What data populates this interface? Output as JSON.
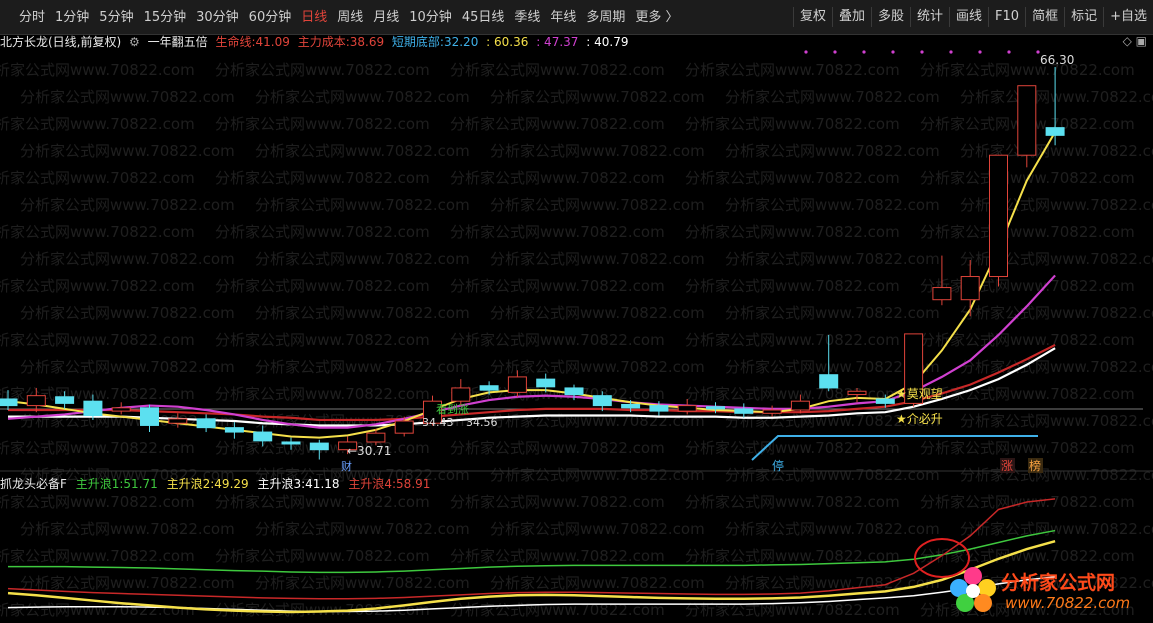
{
  "toolbar": {
    "periods": [
      "分时",
      "1分钟",
      "5分钟",
      "15分钟",
      "30分钟",
      "60分钟",
      "日线",
      "周线",
      "月线",
      "10分钟",
      "45日线",
      "季线",
      "年线",
      "多周期",
      "更多 〉"
    ],
    "active_period": "日线",
    "tools": [
      "复权",
      "叠加",
      "多股",
      "统计",
      "画线",
      "F10",
      "简框",
      "标记",
      "+自选"
    ]
  },
  "upper_info": {
    "stock": "北方长龙(日线,前复权)",
    "indicator_name": "一年翻五倍",
    "life_label": "生命线:",
    "life_value": "41.09",
    "cost_label": "主力成本:",
    "cost_value": "38.69",
    "bottom_label": "短期底部:",
    "bottom_value": "32.20",
    "v1": ": 60.36",
    "v2": ": 47.37",
    "v3": ": 40.79",
    "colors": {
      "life": "#e0443a",
      "cost": "#e0443a",
      "bottom": "#3fb0e8",
      "v1": "#f5e04a",
      "v2": "#d040d0",
      "v3": "#ffffff"
    }
  },
  "lower_info": {
    "indicator_name": "抓龙头必备F",
    "w1_label": "主升浪1:",
    "w1_value": "51.71",
    "w2_label": "主升浪2:",
    "w2_value": "49.29",
    "w3_label": "主升浪3:",
    "w3_value": "41.18",
    "w4_label": "主升浪4:",
    "w4_value": "58.91",
    "colors": {
      "w1": "#3ec83e",
      "w2": "#f5e04a",
      "w3": "#ffffff",
      "w4": "#e0443a"
    }
  },
  "annotations": {
    "high_price": "66.30",
    "low_price": "←30.71",
    "low_label": "财",
    "p1": "34.43",
    "p2": "34.56",
    "see_up": "看到涨",
    "watch": "★莫观望",
    "must_rise": "★介必升",
    "stop": "停",
    "rise": "涨",
    "rank": "榜"
  },
  "watermark": "分析家公式网www.70822.com",
  "logo": {
    "text": "分析家公式网",
    "url": "www.70822.com"
  },
  "chart_data": {
    "type": "candlestick",
    "candles": [
      [
        36.2,
        35.6,
        37.0,
        35.2
      ],
      [
        35.6,
        36.5,
        37.2,
        35.0
      ],
      [
        36.4,
        35.8,
        36.9,
        35.3
      ],
      [
        36.0,
        34.7,
        36.6,
        34.3
      ],
      [
        35.1,
        35.4,
        35.9,
        34.8
      ],
      [
        35.4,
        33.8,
        35.7,
        33.2
      ],
      [
        34.0,
        34.4,
        34.9,
        33.6
      ],
      [
        34.4,
        33.6,
        34.8,
        33.2
      ],
      [
        33.6,
        33.2,
        34.1,
        32.6
      ],
      [
        33.2,
        32.4,
        33.8,
        31.9
      ],
      [
        32.3,
        32.2,
        32.7,
        31.6
      ],
      [
        32.2,
        31.6,
        32.5,
        30.71
      ],
      [
        31.6,
        32.3,
        32.8,
        31.2
      ],
      [
        32.3,
        33.1,
        33.5,
        32.0
      ],
      [
        33.1,
        34.2,
        34.6,
        32.8
      ],
      [
        34.0,
        36.0,
        36.5,
        33.8
      ],
      [
        36.0,
        37.2,
        38.0,
        35.6
      ],
      [
        37.4,
        37.0,
        37.8,
        36.6
      ],
      [
        36.8,
        38.2,
        38.8,
        36.4
      ],
      [
        38.0,
        37.3,
        38.5,
        36.8
      ],
      [
        37.2,
        36.6,
        37.5,
        36.1
      ],
      [
        36.5,
        35.6,
        36.9,
        35.1
      ],
      [
        35.7,
        35.4,
        36.1,
        35.0
      ],
      [
        35.6,
        35.1,
        36.0,
        34.7
      ],
      [
        35.1,
        35.6,
        36.2,
        34.8
      ],
      [
        35.5,
        35.3,
        35.9,
        34.9
      ],
      [
        35.3,
        34.9,
        35.8,
        34.5
      ],
      [
        34.9,
        35.2,
        35.6,
        34.6
      ],
      [
        35.2,
        36.0,
        36.6,
        34.9
      ],
      [
        38.4,
        37.2,
        42.0,
        36.9
      ],
      [
        36.6,
        36.9,
        37.2,
        35.9
      ],
      [
        36.2,
        35.8,
        36.6,
        35.4
      ],
      [
        35.8,
        42.1,
        42.1,
        35.5
      ],
      [
        45.2,
        46.3,
        49.2,
        44.7
      ],
      [
        45.2,
        47.3,
        48.8,
        43.7
      ],
      [
        47.3,
        58.3,
        58.3,
        46.4
      ],
      [
        58.3,
        64.6,
        64.6,
        57.2
      ],
      [
        60.8,
        60.1,
        66.3,
        59.2
      ]
    ],
    "lines": {
      "yellow": [
        36.0,
        35.7,
        35.3,
        34.9,
        34.6,
        34.3,
        34.0,
        33.7,
        33.4,
        33.1,
        32.8,
        32.7,
        32.9,
        33.4,
        34.2,
        35.2,
        36.2,
        36.8,
        37.0,
        37.0,
        36.7,
        36.3,
        35.9,
        35.6,
        35.4,
        35.2,
        35.1,
        35.0,
        35.3,
        36.0,
        36.3,
        36.2,
        37.6,
        40.6,
        44.3,
        49.8,
        56.0,
        60.4
      ],
      "magenta": [
        34.4,
        34.6,
        34.8,
        35.1,
        35.4,
        35.6,
        35.5,
        35.2,
        34.8,
        34.3,
        33.9,
        33.6,
        33.6,
        33.9,
        34.4,
        35.0,
        35.6,
        36.1,
        36.4,
        36.5,
        36.4,
        36.2,
        35.9,
        35.7,
        35.6,
        35.5,
        35.4,
        35.3,
        35.3,
        35.5,
        35.8,
        36.0,
        36.9,
        38.2,
        39.7,
        42.0,
        44.6,
        47.4
      ],
      "red": [
        35.2,
        35.2,
        35.2,
        35.2,
        35.2,
        35.1,
        35.0,
        34.9,
        34.8,
        34.6,
        34.5,
        34.3,
        34.3,
        34.3,
        34.4,
        34.6,
        34.8,
        35.0,
        35.2,
        35.3,
        35.3,
        35.3,
        35.2,
        35.2,
        35.1,
        35.1,
        35.0,
        35.0,
        35.0,
        35.1,
        35.3,
        35.5,
        36.0,
        36.7,
        37.5,
        38.6,
        39.8,
        41.1
      ],
      "white": [
        34.6,
        34.6,
        34.6,
        34.6,
        34.6,
        34.5,
        34.4,
        34.3,
        34.2,
        34.0,
        33.9,
        33.8,
        33.8,
        33.8,
        33.9,
        34.1,
        34.3,
        34.5,
        34.6,
        34.7,
        34.7,
        34.7,
        34.7,
        34.6,
        34.6,
        34.6,
        34.5,
        34.5,
        34.6,
        34.7,
        34.9,
        35.0,
        35.5,
        36.2,
        37.0,
        38.0,
        39.3,
        40.8
      ]
    },
    "lower": {
      "w1": [
        43.5,
        43.5,
        43.5,
        43.4,
        43.3,
        43.2,
        43.0,
        42.8,
        42.6,
        42.5,
        42.3,
        42.2,
        42.2,
        42.3,
        42.5,
        42.8,
        43.1,
        43.4,
        43.6,
        43.7,
        43.8,
        43.8,
        43.8,
        43.8,
        43.8,
        43.8,
        43.8,
        43.9,
        44.0,
        44.2,
        44.4,
        44.6,
        45.2,
        46.2,
        47.5,
        49.0,
        50.5,
        51.71
      ],
      "w2": [
        37.5,
        37.0,
        36.4,
        35.8,
        35.2,
        34.7,
        34.2,
        33.8,
        33.5,
        33.3,
        33.2,
        33.3,
        33.5,
        34.0,
        34.7,
        35.5,
        36.2,
        36.7,
        37.0,
        37.1,
        37.0,
        36.8,
        36.6,
        36.4,
        36.3,
        36.2,
        36.2,
        36.3,
        36.5,
        36.9,
        37.4,
        37.9,
        38.9,
        40.5,
        42.8,
        45.3,
        47.5,
        49.29
      ],
      "w3": [
        34.2,
        34.3,
        34.4,
        34.4,
        34.4,
        34.3,
        34.2,
        34.0,
        33.8,
        33.6,
        33.4,
        33.3,
        33.3,
        33.4,
        33.6,
        33.9,
        34.2,
        34.5,
        34.7,
        34.9,
        35.0,
        35.0,
        35.0,
        35.0,
        35.0,
        35.0,
        35.0,
        35.1,
        35.3,
        35.6,
        36.0,
        36.4,
        36.9,
        37.7,
        38.6,
        39.6,
        40.5,
        41.18
      ],
      "w4": [
        38.5,
        38.2,
        37.9,
        37.6,
        37.4,
        37.2,
        37.0,
        36.8,
        36.6,
        36.4,
        36.3,
        36.2,
        36.2,
        36.3,
        36.5,
        36.8,
        37.1,
        37.4,
        37.6,
        37.7,
        37.7,
        37.6,
        37.5,
        37.4,
        37.3,
        37.2,
        37.2,
        37.3,
        37.5,
        38.0,
        38.7,
        39.4,
        42.0,
        46.0,
        50.5,
        56.5,
        58.2,
        58.91
      ]
    }
  }
}
